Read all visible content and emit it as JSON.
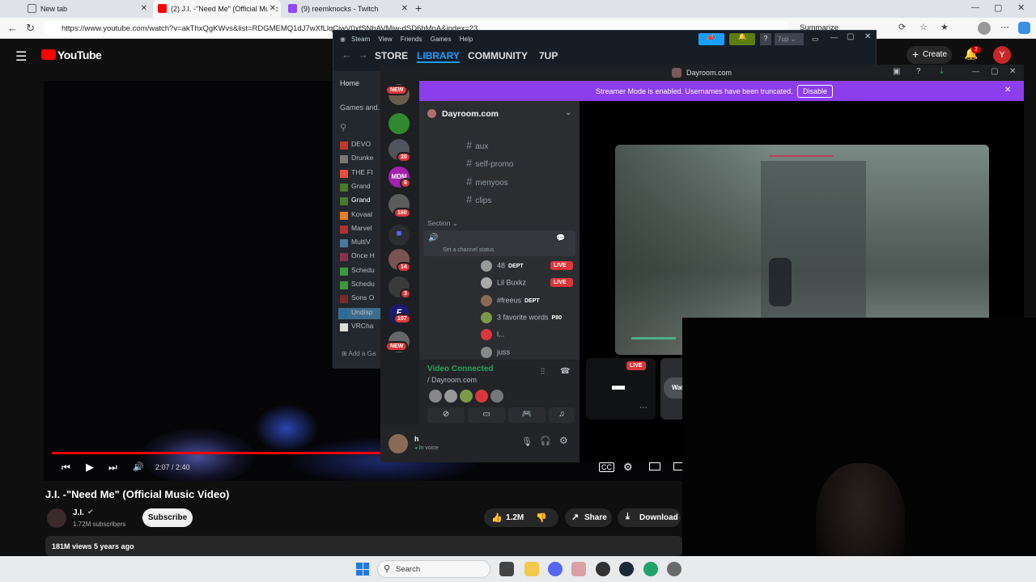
{
  "browser": {
    "tabs": [
      {
        "label": "New tab"
      },
      {
        "label": "(2) J.I. -\"Need Me\" (Official Music"
      },
      {
        "label": "(9) reemknocks - Twitch"
      }
    ],
    "url": "https://www.youtube.com/watch?v=akThxQgKWvs&list=RDGMEMQ1dJ7wXfLlqCjwV0xfSNbAVMiw-dSD6hMnA&index=23",
    "summarize": "Summarize"
  },
  "youtube": {
    "logo": "YouTube",
    "create": "Create",
    "notif_count": "2",
    "avatar_letter": "Y",
    "time": "2:07 / 2:40",
    "progress": 0.79,
    "title": "J.I. -\"Need Me\" (Official Music Video)",
    "channel": "J.I.",
    "subscribers": "1.72M subscribers",
    "subscribe": "Subscribe",
    "likes": "1.2M",
    "share": "Share",
    "download": "Download",
    "meta": "181M views  5 years ago"
  },
  "steam": {
    "menu": [
      "Steam",
      "View",
      "Friends",
      "Games",
      "Help"
    ],
    "nav": [
      "STORE",
      "LIBRARY",
      "COMMUNITY",
      "7UP"
    ],
    "user": "7up",
    "home": "Home",
    "games_and": "Games and...",
    "games": [
      "DEVO",
      "Drunke",
      "THE FI",
      "Grand",
      "Grand",
      "Kovaal",
      "Marvel",
      "MultiV",
      "Once H",
      "Schedu",
      "Schedu",
      "Sons O",
      "Undisp",
      "VRCha"
    ],
    "add_game": "Add a Ga"
  },
  "discord": {
    "window_title": "Dayroom.com",
    "banner": "Streamer Mode is enabled. Usernames have been truncated.",
    "disable": "Disable",
    "server": "Dayroom.com",
    "channels": [
      "aux",
      "self-promo",
      "menyoos",
      "clips"
    ],
    "section": "Section",
    "channel_status": "Set a channel status",
    "voice_users": [
      {
        "name": "48",
        "tag": "DEPT",
        "live": "LIVE"
      },
      {
        "name": "Lil Buxkz",
        "tag": "",
        "live": "LIVE"
      },
      {
        "name": "#freeus",
        "tag": "DEPT",
        "live": ""
      },
      {
        "name": "3 favorite words",
        "tag": "P80",
        "live": ""
      },
      {
        "name": "l...",
        "tag": "",
        "live": ""
      },
      {
        "name": "juss",
        "tag": "",
        "live": ""
      }
    ],
    "server_badges": [
      "NEW",
      "20",
      "6",
      "160",
      "14",
      "3",
      "197",
      "NEW"
    ],
    "video_connected": "Video Connected",
    "voice_location": "/ Dayroom.com",
    "user_name": "h",
    "user_status": "In voice",
    "stream_live": "LIVE",
    "watch": "Wat"
  },
  "taskbar": {
    "search": "Search"
  }
}
